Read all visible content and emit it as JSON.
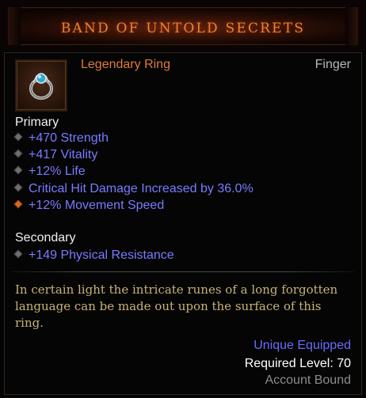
{
  "item": {
    "name": "BAND OF UNTOLD SECRETS",
    "rarity_type": "Legendary Ring",
    "slot": "Finger",
    "icon": "ring-icon"
  },
  "primary": {
    "label": "Primary",
    "stats": [
      {
        "text": "+470 Strength",
        "bullet": "normal"
      },
      {
        "text": "+417 Vitality",
        "bullet": "normal"
      },
      {
        "text": "+12% Life",
        "bullet": "normal"
      },
      {
        "text": "Critical Hit Damage Increased by 36.0%",
        "bullet": "normal"
      },
      {
        "text": "+12% Movement Speed",
        "bullet": "legendary"
      }
    ]
  },
  "secondary": {
    "label": "Secondary",
    "stats": [
      {
        "text": "+149 Physical Resistance",
        "bullet": "normal"
      }
    ]
  },
  "flavor_text": "In certain light the intricate runes of a long forgotten language can be made out upon the surface of this ring.",
  "footer": {
    "unique": "Unique Equipped",
    "required_level": "Required Level: 70",
    "binding": "Account Bound"
  },
  "colors": {
    "title": "#f08030",
    "legendary": "#e07a3c",
    "magic_stat": "#7a7aff",
    "flavor": "#c7b377"
  }
}
